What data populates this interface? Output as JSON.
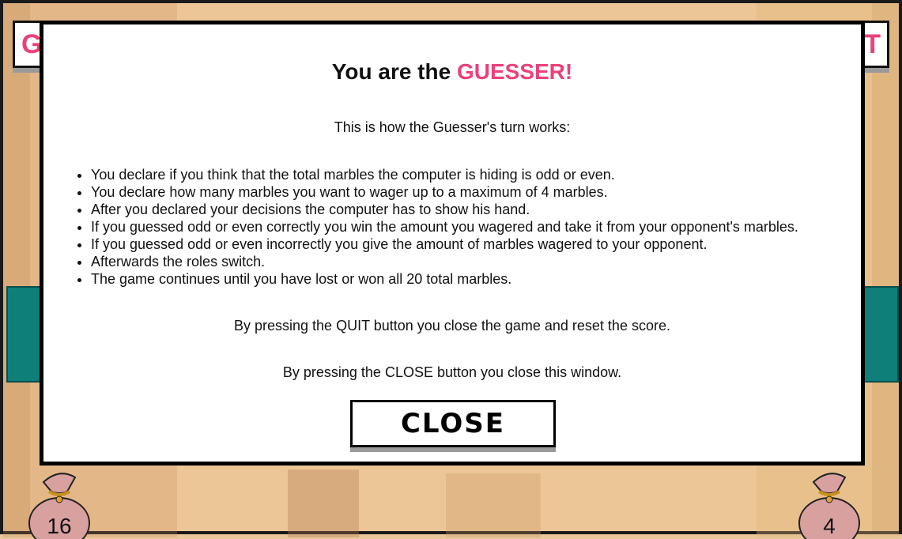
{
  "background": {
    "top_left_text": "G",
    "top_right_text": "T",
    "player_marbles": "16",
    "computer_marbles": "4"
  },
  "modal": {
    "title_prefix": "You are the ",
    "title_role": "GUESSER!",
    "intro": "This is how the Guesser's turn works:",
    "rules": [
      "You declare if you think that the total marbles the computer is hiding is odd or even.",
      "You declare how many marbles you want to wager up to a maximum of 4 marbles.",
      "After you declared your decisions the computer has to show his hand.",
      "If you guessed odd or even correctly you win the amount you wagered and take it from your opponent's marbles.",
      "If you guessed odd or even incorrectly you give the amount of marbles wagered to your opponent.",
      "Afterwards the roles switch.",
      "The game continues until you have lost or won all 20 total marbles."
    ],
    "quit_note": "By pressing the QUIT button you close the game and reset the score.",
    "close_note": "By pressing the CLOSE button you close this window.",
    "close_label": "CLOSE"
  },
  "colors": {
    "accent": "#ec407a",
    "panel": "#0f7f7a",
    "bag": "#d9a0a0"
  }
}
